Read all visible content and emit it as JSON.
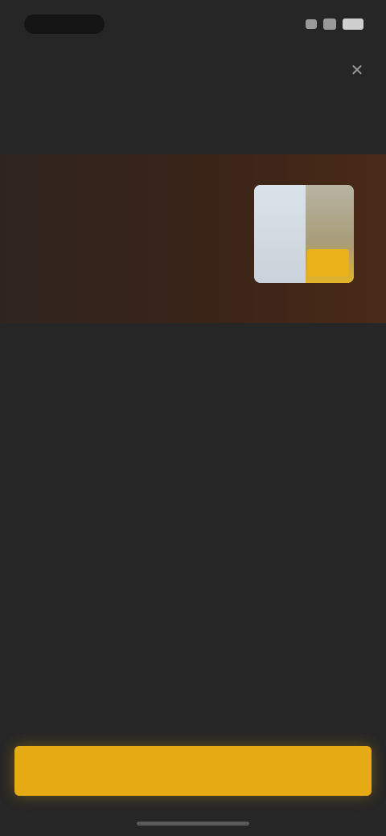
{
  "status_bar": {
    "time": "",
    "icons": [
      "signal-icon",
      "wifi-icon",
      "battery-icon"
    ]
  },
  "header": {
    "title": "",
    "close_icon": "close-icon",
    "tabs": [
      "",
      "",
      "",
      ""
    ]
  },
  "hero": {
    "title": "",
    "subtitle": "",
    "image_icon": "product-image"
  },
  "description": "",
  "details": {
    "heading": "",
    "rows": [
      {
        "label": "",
        "value": ""
      },
      {
        "label": "",
        "value": ""
      },
      {
        "label": "",
        "value": ""
      },
      {
        "label": "",
        "value": ""
      },
      {
        "label": "",
        "value": ""
      },
      {
        "label": "",
        "value": ""
      }
    ]
  },
  "footer_note": "",
  "cta": {
    "label": ""
  },
  "colors": {
    "background": "#262626",
    "accent": "#e6ab14",
    "hero_background": "#3a2418"
  }
}
